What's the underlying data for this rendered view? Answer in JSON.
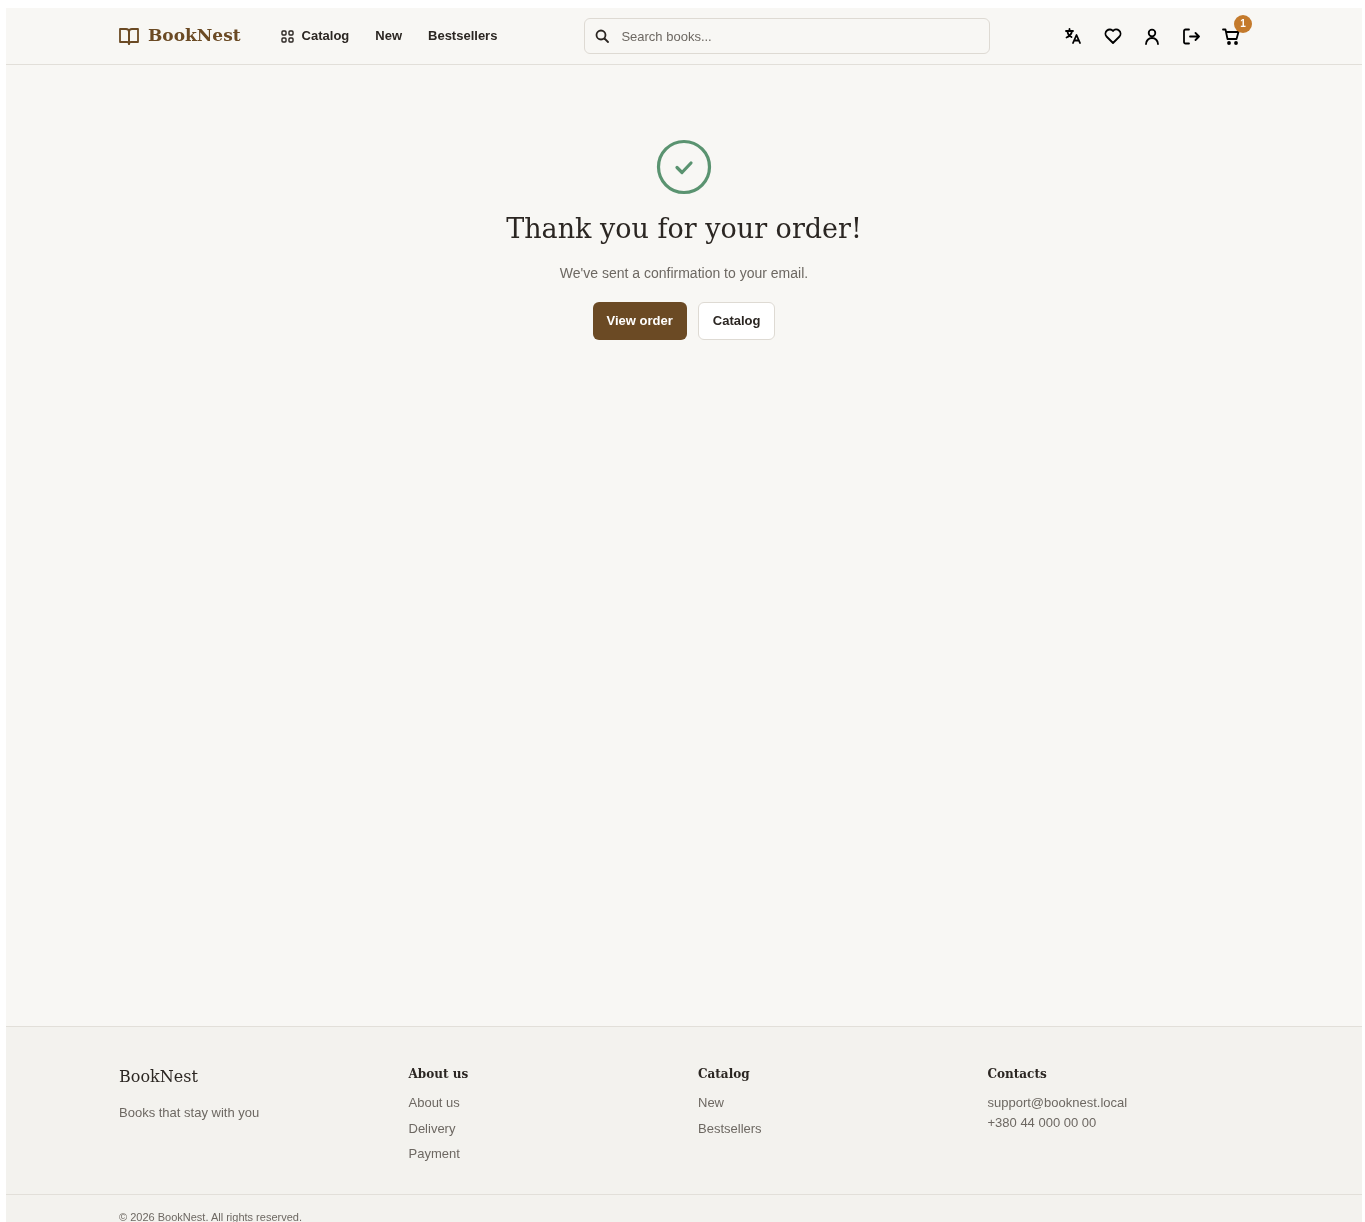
{
  "header": {
    "logo": "BookNest",
    "nav": [
      "Catalog",
      "New",
      "Bestsellers"
    ],
    "search": {
      "placeholder": "Search books..."
    },
    "cart_count": "1"
  },
  "confirmation": {
    "title": "Thank you for your order!",
    "message": "We've sent a confirmation to your email.",
    "buttons": [
      {
        "label": "View order",
        "kind": "primary"
      },
      {
        "label": "Catalog",
        "kind": "outline"
      }
    ]
  },
  "footer": {
    "brand": "BookNest",
    "tagline": "Books that stay with you",
    "columns": [
      {
        "title": "About us",
        "links": [
          "About us",
          "Delivery",
          "Payment"
        ]
      },
      {
        "title": "Catalog",
        "links": [
          "New",
          "Bestsellers"
        ]
      },
      {
        "title": "Contacts",
        "lines": [
          "support@booknest.local",
          "+380 44 000 00 00"
        ]
      }
    ],
    "copyright": "© 2026 BookNest. All rights reserved."
  }
}
